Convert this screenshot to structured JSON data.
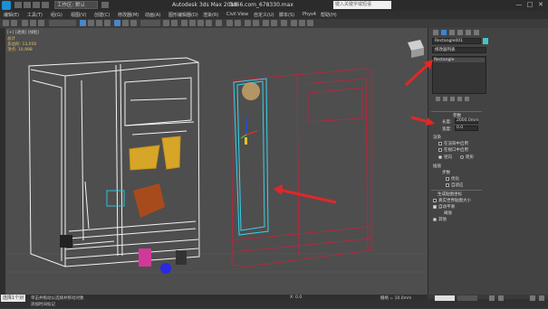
{
  "title_bar": {
    "workspace_label": "工作区: 默认",
    "app_title": "Autodesk 3ds Max 2016",
    "file_name": "3d66.com_678330.max",
    "search_placeholder": "键入关键字或短语",
    "window_buttons": [
      "—",
      "□",
      "✕"
    ]
  },
  "menu": {
    "items": [
      "编辑(E)",
      "工具(T)",
      "组(G)",
      "视图(V)",
      "创建(C)",
      "修改器(M)",
      "动画(A)",
      "图形编辑器(D)",
      "渲染(R)",
      "Civil View",
      "自定义(U)",
      "脚本(S)",
      "Phys4",
      "帮助(H)"
    ]
  },
  "viewport": {
    "label": "[+] [透视] [线框]",
    "stats": [
      "总计",
      "多边形: 13,056",
      "顶点: 10,998"
    ],
    "annotation_color": "#e02828"
  },
  "panel": {
    "object_name": "Rectangle001",
    "modifier_list_label": "修改器列表",
    "stack_item": "Rectangle",
    "rollout_title": "参数",
    "length_label": "长度:",
    "length_value": "2000.0mm",
    "width_label": "宽度:",
    "width_value": "0.0",
    "section_render": "渲染",
    "enable_in_renderer": "在渲染中启用",
    "enable_in_viewport": "在视口中启用",
    "radial": "径向",
    "rectangular": "矩形",
    "section_interp": "插值",
    "steps_label": "步数",
    "optimize": "优化",
    "adaptive": "自适应",
    "generate_mapping": "生成贴图坐标",
    "real_world": "真实世界贴图大小",
    "auto_smooth": "自动平滑",
    "threshold": "阈值",
    "section_misc": "其他"
  },
  "status": {
    "badge": "选择1个对象",
    "prompt": "单击并拖动以选择并移动对象",
    "x_value": "X: 0.0",
    "grid": "栅格 = 10.0mm",
    "add_time_tag": "添加时间标记"
  }
}
